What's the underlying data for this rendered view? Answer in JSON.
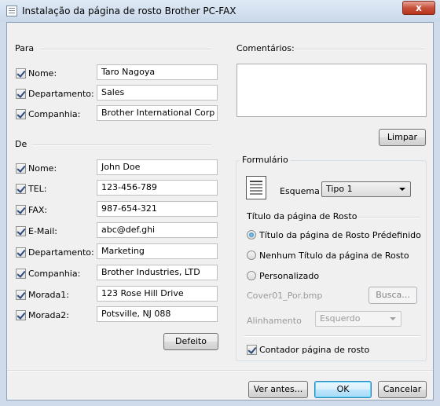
{
  "window": {
    "title": "Instalação da página de rosto Brother PC-FAX",
    "close_label": "x"
  },
  "para": {
    "section_label": "Para",
    "rows": [
      {
        "label": "Nome:",
        "value": "Taro Nagoya",
        "checked": true
      },
      {
        "label": "Departamento:",
        "value": "Sales",
        "checked": true
      },
      {
        "label": "Companhia:",
        "value": "Brother International Corp",
        "checked": true
      }
    ]
  },
  "de": {
    "section_label": "De",
    "rows": [
      {
        "label": "Nome:",
        "value": "John Doe",
        "checked": true
      },
      {
        "label": "TEL:",
        "value": "123-456-789",
        "checked": true
      },
      {
        "label": "FAX:",
        "value": "987-654-321",
        "checked": true
      },
      {
        "label": "E-Mail:",
        "value": "abc@def.ghi",
        "checked": true
      },
      {
        "label": "Departamento:",
        "value": "Marketing",
        "checked": true
      },
      {
        "label": "Companhia:",
        "value": "Brother Industries, LTD",
        "checked": true
      },
      {
        "label": "Morada1:",
        "value": "123 Rose Hill Drive",
        "checked": true
      },
      {
        "label": "Morada2:",
        "value": "Potsville, NJ 088",
        "checked": true
      }
    ],
    "default_button": "Defeito"
  },
  "comments": {
    "label": "Comentários:",
    "value": "",
    "clear_button": "Limpar"
  },
  "form": {
    "group_label": "Formulário",
    "scheme_label": "Esquema",
    "scheme_value": "Tipo 1",
    "title_section_label": "Título da página de Rosto",
    "options": [
      {
        "label": "Título da página de Rosto Prédefinido",
        "selected": true
      },
      {
        "label": "Nenhum Título da página de Rosto",
        "selected": false
      },
      {
        "label": "Personalizado",
        "selected": false
      }
    ],
    "file_name": "Cover01_Por.bmp",
    "browse_button": "Busca...",
    "alignment_label": "Alinhamento",
    "alignment_value": "Esquerdo",
    "counter_label": "Contador página de rosto",
    "counter_checked": true
  },
  "footer": {
    "preview_button": "Ver antes...",
    "ok_button": "OK",
    "cancel_button": "Cancelar"
  }
}
